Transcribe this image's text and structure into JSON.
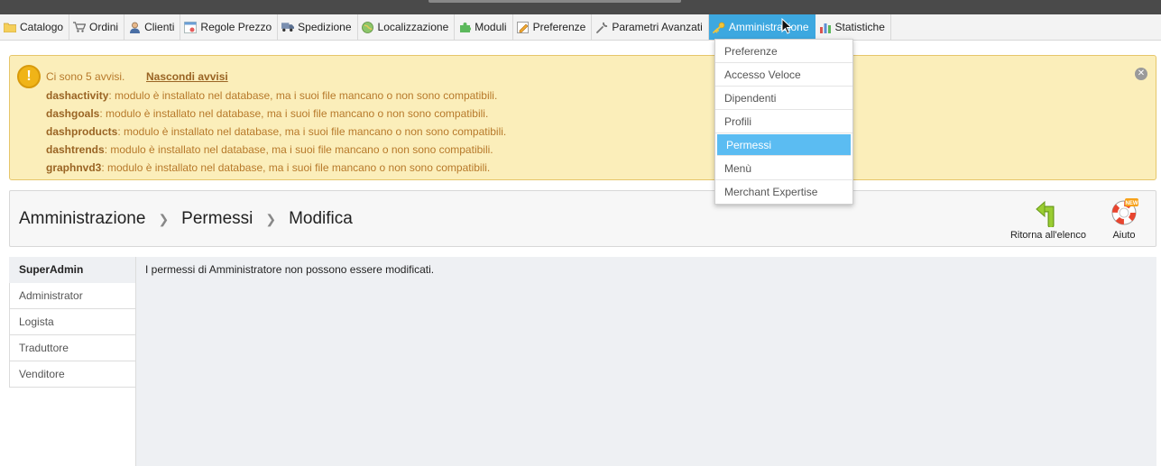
{
  "menu": {
    "tabs": [
      {
        "label": "Catalogo",
        "icon": "folder-icon"
      },
      {
        "label": "Ordini",
        "icon": "cart-icon"
      },
      {
        "label": "Clienti",
        "icon": "user-icon"
      },
      {
        "label": "Regole Prezzo",
        "icon": "price-rules-icon"
      },
      {
        "label": "Spedizione",
        "icon": "truck-icon"
      },
      {
        "label": "Localizzazione",
        "icon": "globe-icon"
      },
      {
        "label": "Moduli",
        "icon": "puzzle-icon"
      },
      {
        "label": "Preferenze",
        "icon": "preferences-icon"
      },
      {
        "label": "Parametri Avanzati",
        "icon": "wrench-icon"
      },
      {
        "label": "Amministrazione",
        "icon": "key-icon"
      },
      {
        "label": "Statistiche",
        "icon": "bar-chart-icon"
      }
    ],
    "active_tab": "Amministrazione"
  },
  "dropdown": {
    "items": [
      "Preferenze",
      "Accesso Veloce",
      "Dipendenti",
      "Profili",
      "Permessi",
      "Menù",
      "Merchant Expertise"
    ],
    "selected": "Permessi"
  },
  "warnings": {
    "count_text": "Ci sono 5 avvisi.",
    "hide_link": "Nascondi avvisi",
    "items": [
      {
        "module": "dashactivity",
        "text": ": modulo è installato nel database, ma i suoi file mancano o non sono compatibili."
      },
      {
        "module": "dashgoals",
        "text": ": modulo è installato nel database, ma i suoi file mancano o non sono compatibili."
      },
      {
        "module": "dashproducts",
        "text": ": modulo è installato nel database, ma i suoi file mancano o non sono compatibili."
      },
      {
        "module": "dashtrends",
        "text": ": modulo è installato nel database, ma i suoi file mancano o non sono compatibili."
      },
      {
        "module": "graphnvd3",
        "text": ": modulo è installato nel database, ma i suoi file mancano o non sono compatibili."
      }
    ]
  },
  "breadcrumb": [
    "Amministrazione",
    "Permessi",
    "Modifica"
  ],
  "toolbar": {
    "back_label": "Ritorna all'elenco",
    "help_label": "Aiuto",
    "help_badge": "NEW"
  },
  "profiles": [
    "SuperAdmin",
    "Administrator",
    "Logista",
    "Traduttore",
    "Venditore"
  ],
  "selected_profile": "SuperAdmin",
  "main": {
    "message": "I permessi di Amministratore non possono essere modificati."
  },
  "colors": {
    "accent": "#3da8e0",
    "dropdown_selected": "#5bbcf2",
    "warning_bg": "#fbeeba",
    "warning_text": "#b7792a"
  }
}
